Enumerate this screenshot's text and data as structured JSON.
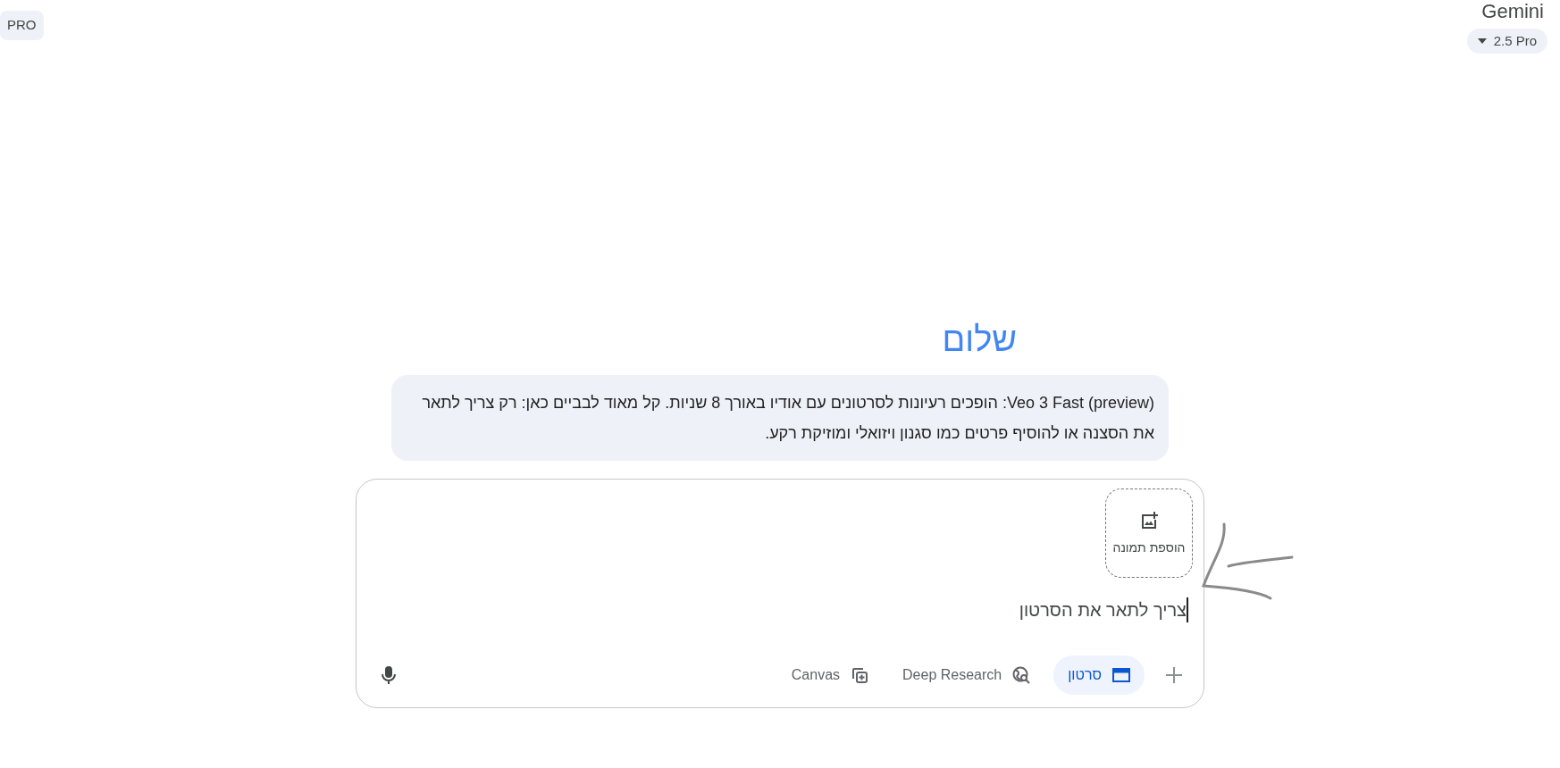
{
  "header": {
    "plan_badge": "PRO",
    "app_name": "Gemini",
    "model_picker": "2.5 Pro"
  },
  "greeting": "שלום",
  "tip_bubble": "Veo 3 Fast (preview): הופכים רעיונות לסרטונים עם אודיו באורך 8 שניות. קל מאוד לבביים כאן: רק צריך לתאר את הסצנה או להוסיף פרטים כמו סגנון ויזואלי ומוזיקת רקע.",
  "prompt": {
    "add_image": "הוספת תמונה",
    "value": "צריך לתאר את הסרטון",
    "tools": [
      {
        "kind": "video",
        "label": "סרטון",
        "selected": true
      },
      {
        "kind": "research",
        "label": "Deep Research",
        "selected": false
      },
      {
        "kind": "canvas",
        "label": "Canvas",
        "selected": false
      }
    ]
  }
}
